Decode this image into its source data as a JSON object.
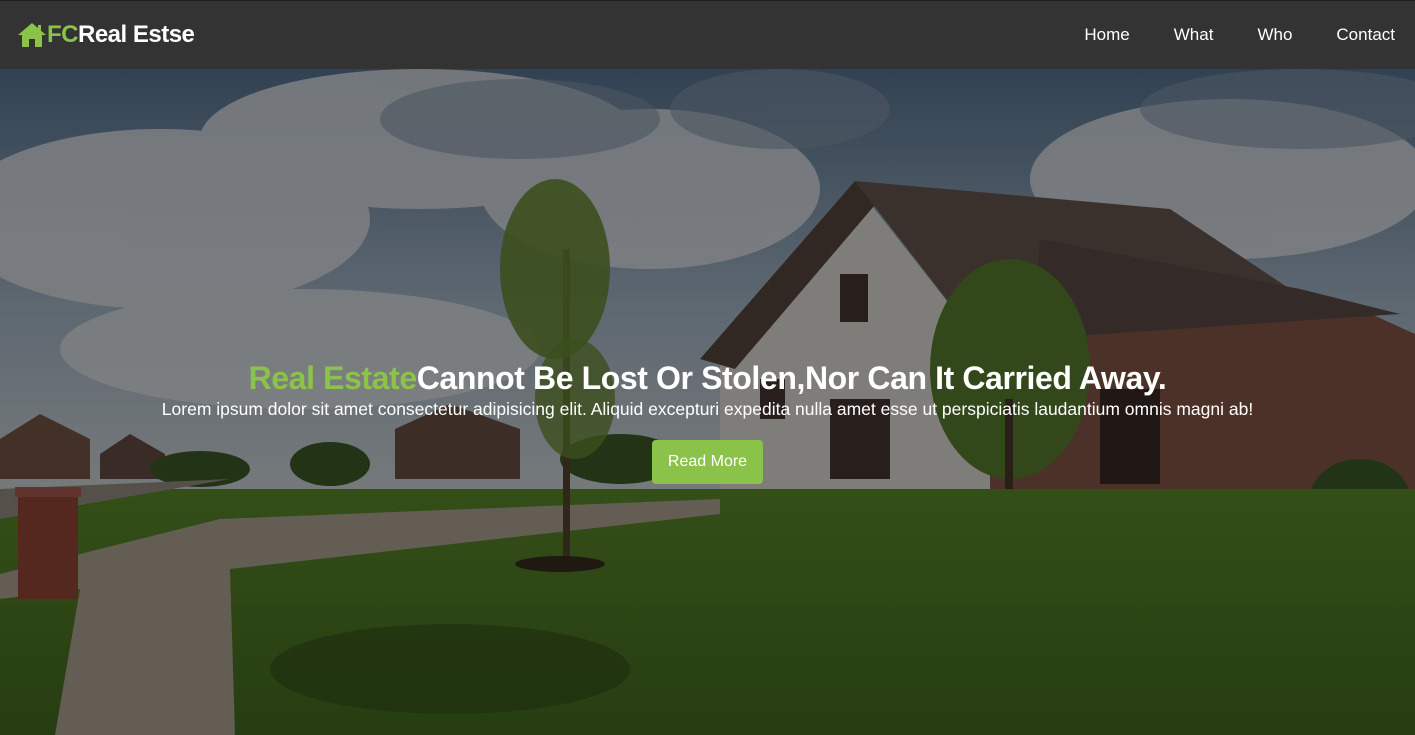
{
  "brand": {
    "prefix": "FC",
    "name": "Real Estse",
    "icon": "house-icon",
    "accent_color": "#8bc34a"
  },
  "nav": {
    "items": [
      {
        "label": "Home"
      },
      {
        "label": "What"
      },
      {
        "label": "Who"
      },
      {
        "label": "Contact"
      }
    ]
  },
  "hero": {
    "headline_accent": "Real Estate",
    "headline_rest": "Cannot Be Lost Or Stolen,Nor Can It Carried Away.",
    "subtext": "Lorem ipsum dolor sit amet consectetur adipisicing elit. Aliquid excepturi expedita nulla amet esse ut perspiciatis laudantium omnis magni ab!",
    "cta_label": "Read More"
  },
  "colors": {
    "navbar": "#333333",
    "accent": "#8bc34a",
    "text": "#ffffff"
  }
}
